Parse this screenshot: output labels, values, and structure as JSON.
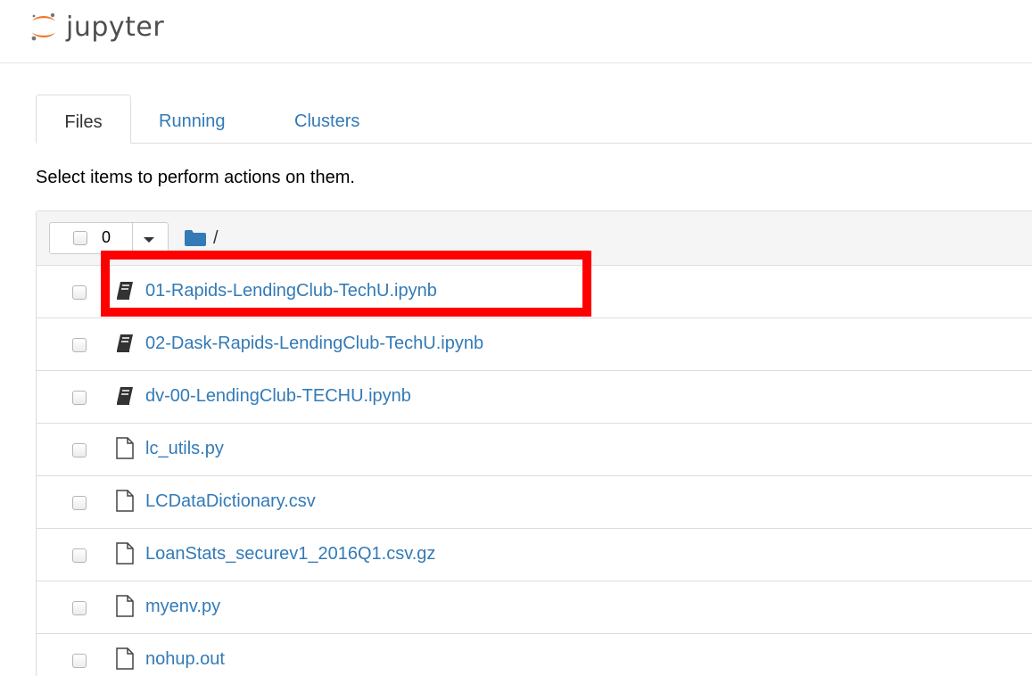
{
  "header": {
    "logo_text": "jupyter",
    "logo_icon": "jupyter-logo-icon",
    "colors": {
      "logo_orange": "#f37726",
      "logo_gray": "#767677"
    }
  },
  "tabs": [
    {
      "label": "Files",
      "active": true
    },
    {
      "label": "Running",
      "active": false
    },
    {
      "label": "Clusters",
      "active": false
    }
  ],
  "instructions": "Select items to perform actions on them.",
  "list_header": {
    "selected_count": "0",
    "folder_icon": "folder-icon",
    "path": "/"
  },
  "files": [
    {
      "name": "01-Rapids-LendingClub-TechU.ipynb",
      "type": "notebook",
      "icon": "notebook-icon",
      "highlighted": true
    },
    {
      "name": "02-Dask-Rapids-LendingClub-TechU.ipynb",
      "type": "notebook",
      "icon": "notebook-icon"
    },
    {
      "name": "dv-00-LendingClub-TECHU.ipynb",
      "type": "notebook",
      "icon": "notebook-icon"
    },
    {
      "name": "lc_utils.py",
      "type": "file",
      "icon": "file-icon"
    },
    {
      "name": "LCDataDictionary.csv",
      "type": "file",
      "icon": "file-icon"
    },
    {
      "name": "LoanStats_securev1_2016Q1.csv.gz",
      "type": "file",
      "icon": "file-icon"
    },
    {
      "name": "myenv.py",
      "type": "file",
      "icon": "file-icon"
    },
    {
      "name": "nohup.out",
      "type": "file",
      "icon": "file-icon"
    }
  ],
  "colors": {
    "link": "#337ab7",
    "highlight": "#ff0000",
    "border": "#dddddd",
    "header_bg": "#f5f5f5"
  }
}
